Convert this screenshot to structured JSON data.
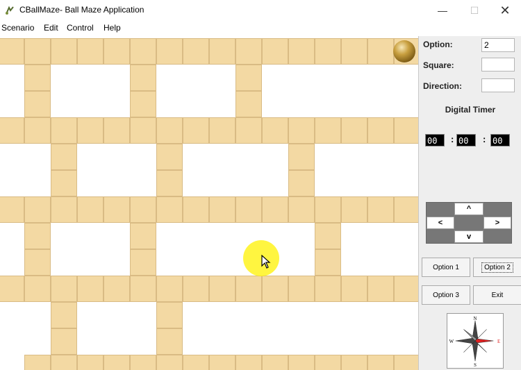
{
  "window": {
    "title": "CBallMaze- Ball Maze Application",
    "minimize_label": "—",
    "maximize_label": "☐",
    "close_label": "✕"
  },
  "menu": {
    "items": [
      "Scenario",
      "Edit",
      "Control",
      "Help"
    ]
  },
  "panel": {
    "option_label": "Option:",
    "option_value": "2",
    "square_label": "Square:",
    "square_value": "",
    "direction_label": "Direction:",
    "direction_value": "",
    "timer_title": "Digital Timer",
    "timer": {
      "hours": "00",
      "minutes": "00",
      "seconds": "00",
      "separator": ":"
    },
    "dpad": {
      "up": "^",
      "left": "<",
      "right": ">",
      "down": "v"
    },
    "buttons": {
      "option1": "Option 1",
      "option2": "Option 2",
      "option3": "Option 3",
      "exit": "Exit"
    },
    "compass": {
      "n": "N",
      "e": "E",
      "s": "S",
      "w": "W"
    }
  },
  "colors": {
    "tile": "#f3d9a3",
    "tile_border": "#d9bb84",
    "ball": "#c9a040",
    "timer_bg": "#000000",
    "panel_bg": "#eeeeee",
    "compass_needle": "#e02020"
  },
  "icons": [
    "ball-maze-app-icon",
    "cursor-arrow-icon",
    "compass-rose-icon",
    "gold-ball-icon"
  ]
}
